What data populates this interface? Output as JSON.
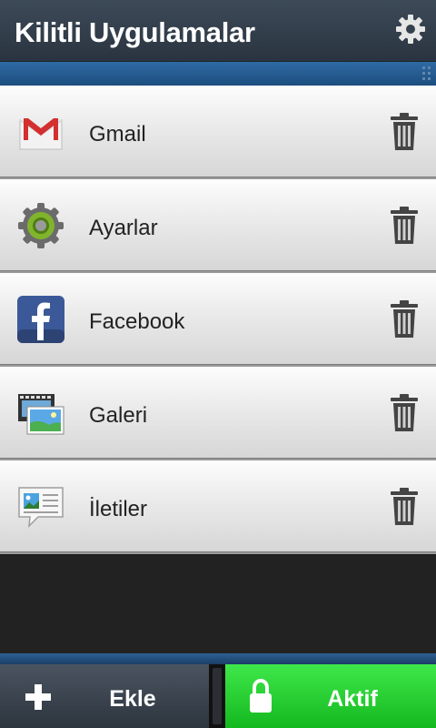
{
  "header": {
    "title": "Kilitli Uygulamalar",
    "settings_icon": "gear-icon"
  },
  "locked_apps": [
    {
      "label": "Gmail",
      "icon": "gmail-icon",
      "action_icon": "trash-icon"
    },
    {
      "label": "Ayarlar",
      "icon": "settings-app-icon",
      "action_icon": "trash-icon"
    },
    {
      "label": "Facebook",
      "icon": "facebook-icon",
      "action_icon": "trash-icon"
    },
    {
      "label": "Galeri",
      "icon": "gallery-icon",
      "action_icon": "trash-icon"
    },
    {
      "label": "İletiler",
      "icon": "messages-icon",
      "action_icon": "trash-icon"
    }
  ],
  "footer": {
    "add_label": "Ekle",
    "add_icon": "plus-icon",
    "active_label": "Aktif",
    "active_icon": "lock-icon"
  },
  "colors": {
    "header_bg": "#34404c",
    "accent_blue": "#2f6aa3",
    "active_green": "#1fd02a",
    "list_bg": "#e6e6e6"
  }
}
